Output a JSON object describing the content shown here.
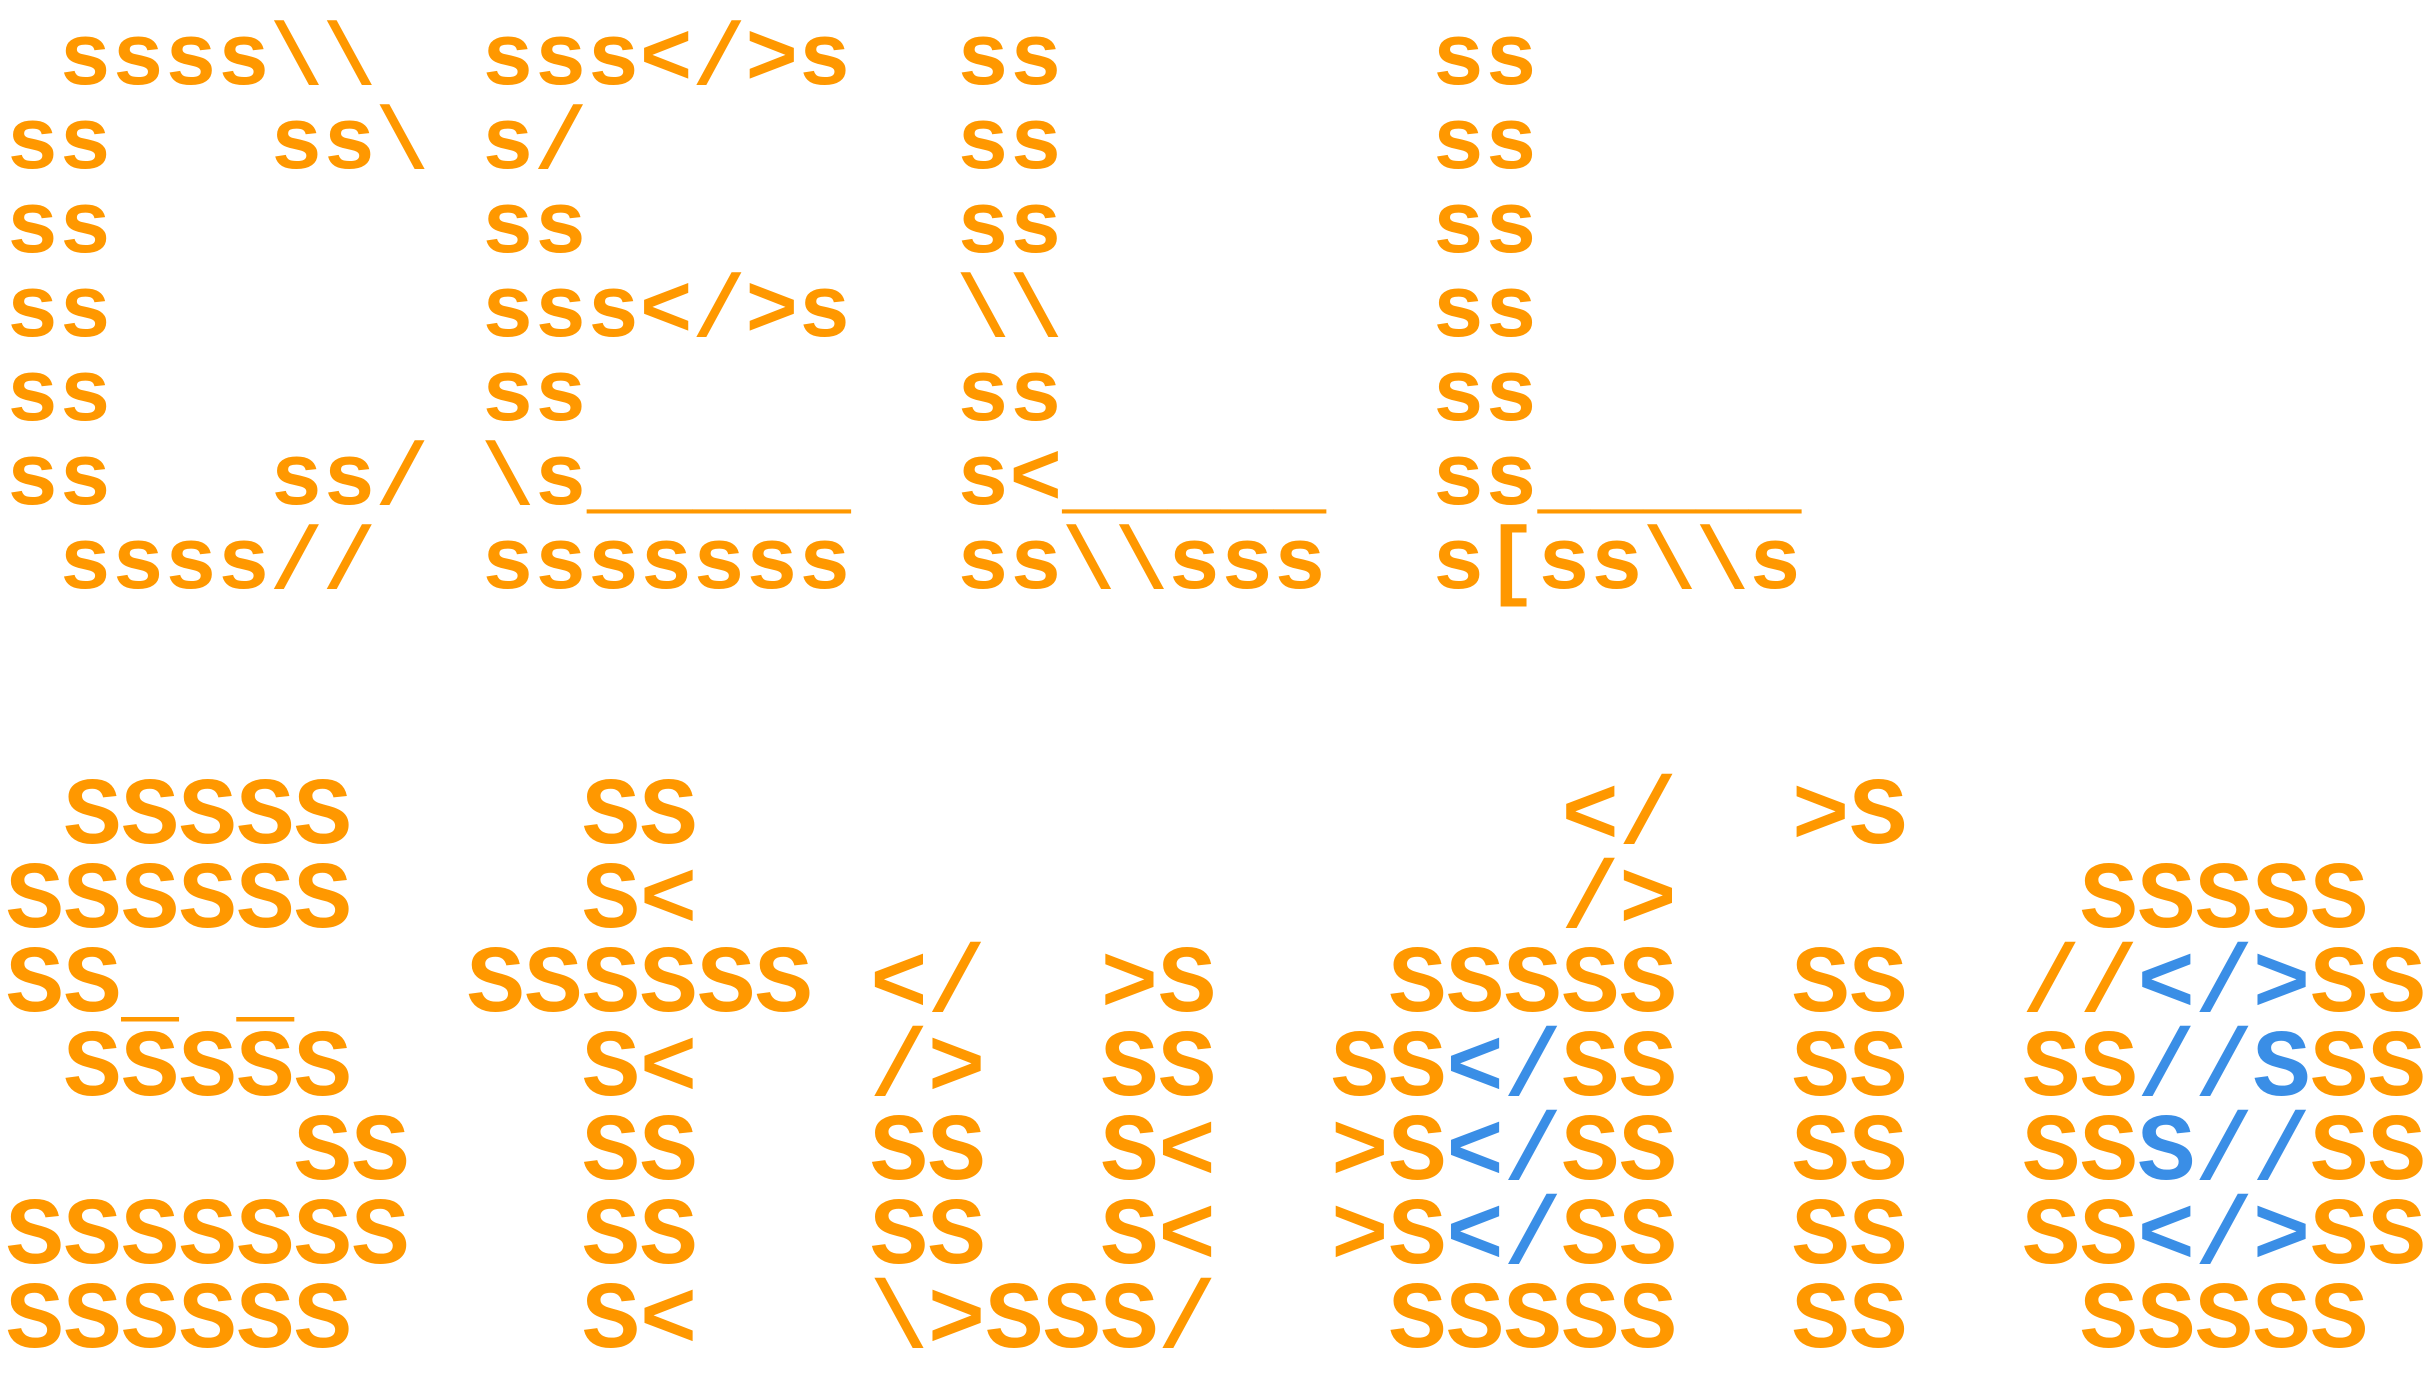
{
  "colors": {
    "primary": "#FF9800",
    "accent": "#3A8EE6"
  },
  "art_top": [
    [
      {
        "t": " ssss\\\\  sss</>s  ss       ss",
        "c": "primary"
      }
    ],
    [
      {
        "t": "ss   ss\\ s/       ss       ss",
        "c": "primary"
      }
    ],
    [
      {
        "t": "ss       ss       ss       ss",
        "c": "primary"
      }
    ],
    [
      {
        "t": "ss       sss</>s  \\\\       ss",
        "c": "primary"
      }
    ],
    [
      {
        "t": "ss       ss       ss       ss",
        "c": "primary"
      }
    ],
    [
      {
        "t": "ss   ss/ \\s_____  s<_____  ss_____",
        "c": "primary"
      }
    ],
    [
      {
        "t": " ssss//  sssssss  ss\\\\sss  s[ss\\\\s",
        "c": "primary"
      }
    ]
  ],
  "art_bottom": [
    [
      {
        "t": " SSSSS    SS               </  >S",
        "c": "primary"
      }
    ],
    [
      {
        "t": "SSSSSS    S<               />       SSSSS",
        "c": "primary"
      }
    ],
    [
      {
        "t": "SS_ _   SSSSSS </  >S   SSSSS  SS  //",
        "c": "primary"
      },
      {
        "t": "</>",
        "c": "accent"
      },
      {
        "t": "SS",
        "c": "primary"
      }
    ],
    [
      {
        "t": " SSSSS    S<   />  SS  SS",
        "c": "primary"
      },
      {
        "t": "</",
        "c": "accent"
      },
      {
        "t": "SS  SS  SS",
        "c": "primary"
      },
      {
        "t": "//S",
        "c": "accent"
      },
      {
        "t": "SS",
        "c": "primary"
      }
    ],
    [
      {
        "t": "     SS   SS   SS  S<  >S",
        "c": "primary"
      },
      {
        "t": "</",
        "c": "accent"
      },
      {
        "t": "SS  SS  SS",
        "c": "primary"
      },
      {
        "t": "S//",
        "c": "accent"
      },
      {
        "t": "SS",
        "c": "primary"
      }
    ],
    [
      {
        "t": "SSSSSSS   SS   SS  S<  >S",
        "c": "primary"
      },
      {
        "t": "</",
        "c": "accent"
      },
      {
        "t": "SS  SS  SS",
        "c": "primary"
      },
      {
        "t": "</>",
        "c": "accent"
      },
      {
        "t": "SS",
        "c": "primary"
      }
    ],
    [
      {
        "t": "SSSSSS    S<   \\>SSS/   SSSSS  SS   SSSSS",
        "c": "primary"
      }
    ]
  ]
}
